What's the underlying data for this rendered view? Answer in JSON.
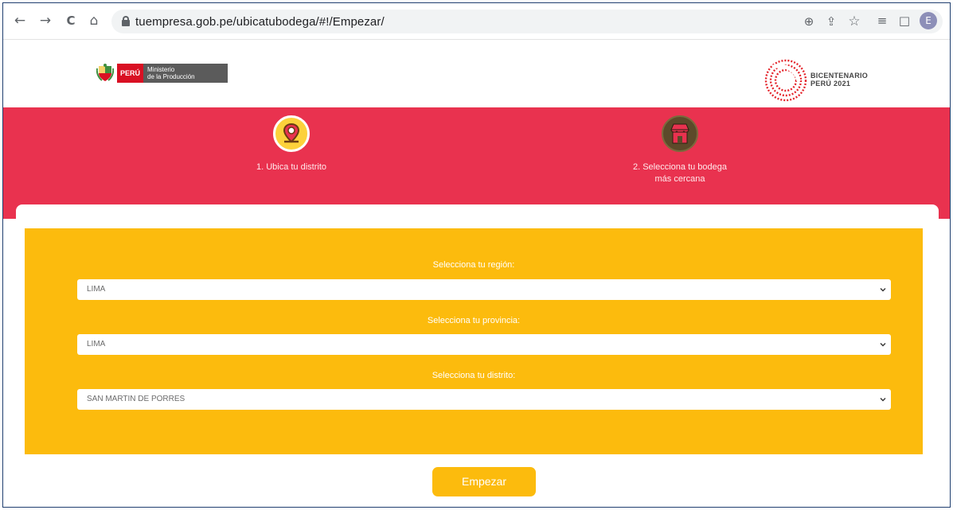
{
  "browser": {
    "url": "tuempresa.gob.pe/ubicatubodega/#!/Empezar/",
    "nav": {
      "back": "←",
      "forward": "→",
      "reload": "C",
      "home": "⌂"
    },
    "tools": {
      "zoom": "⊕",
      "share": "⇪",
      "bookmark": "☆",
      "reading_list": "≡",
      "side_panel": "□"
    },
    "profile_initial": "E"
  },
  "header": {
    "left_logo": {
      "peru": "PERÚ",
      "ministry_line1": "Ministerio",
      "ministry_line2": "de la Producción"
    },
    "right_logo": {
      "line1": "BICENTENARIO",
      "line2": "PERÚ 2021"
    }
  },
  "steps": [
    {
      "label": "1. Ubica tu distrito",
      "icon": "map-pin-icon"
    },
    {
      "label_line1": "2. Selecciona tu bodega",
      "label_line2": "más cercana",
      "icon": "store-icon"
    }
  ],
  "form": {
    "region_label": "Selecciona tu región:",
    "region_value": "LIMA",
    "province_label": "Selecciona tu provincia:",
    "province_value": "LIMA",
    "district_label": "Selecciona tu distrito:",
    "district_value": "SAN MARTIN DE PORRES"
  },
  "start_button": "Empezar",
  "colors": {
    "band": "#e9324f",
    "panel": "#fcbb0d",
    "button": "#fcbb0d"
  }
}
